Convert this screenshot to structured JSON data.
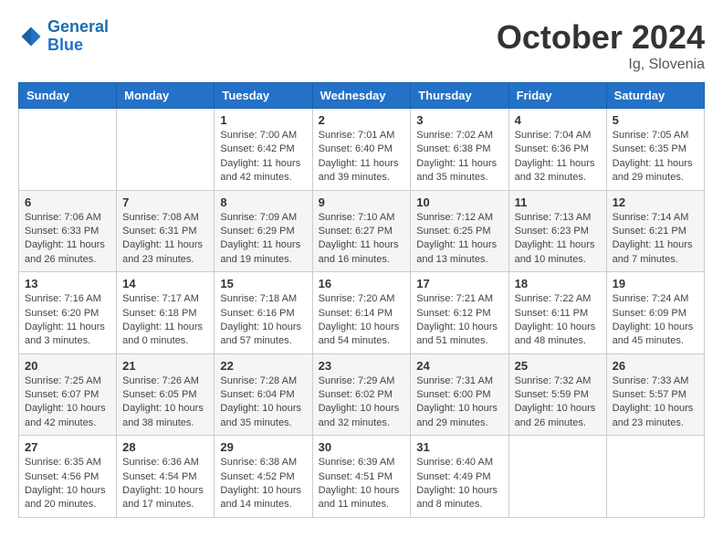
{
  "header": {
    "logo_general": "General",
    "logo_blue": "Blue",
    "month_title": "October 2024",
    "location": "Ig, Slovenia"
  },
  "weekdays": [
    "Sunday",
    "Monday",
    "Tuesday",
    "Wednesday",
    "Thursday",
    "Friday",
    "Saturday"
  ],
  "weeks": [
    [
      {
        "day": "",
        "info": ""
      },
      {
        "day": "",
        "info": ""
      },
      {
        "day": "1",
        "info": "Sunrise: 7:00 AM\nSunset: 6:42 PM\nDaylight: 11 hours and 42 minutes."
      },
      {
        "day": "2",
        "info": "Sunrise: 7:01 AM\nSunset: 6:40 PM\nDaylight: 11 hours and 39 minutes."
      },
      {
        "day": "3",
        "info": "Sunrise: 7:02 AM\nSunset: 6:38 PM\nDaylight: 11 hours and 35 minutes."
      },
      {
        "day": "4",
        "info": "Sunrise: 7:04 AM\nSunset: 6:36 PM\nDaylight: 11 hours and 32 minutes."
      },
      {
        "day": "5",
        "info": "Sunrise: 7:05 AM\nSunset: 6:35 PM\nDaylight: 11 hours and 29 minutes."
      }
    ],
    [
      {
        "day": "6",
        "info": "Sunrise: 7:06 AM\nSunset: 6:33 PM\nDaylight: 11 hours and 26 minutes."
      },
      {
        "day": "7",
        "info": "Sunrise: 7:08 AM\nSunset: 6:31 PM\nDaylight: 11 hours and 23 minutes."
      },
      {
        "day": "8",
        "info": "Sunrise: 7:09 AM\nSunset: 6:29 PM\nDaylight: 11 hours and 19 minutes."
      },
      {
        "day": "9",
        "info": "Sunrise: 7:10 AM\nSunset: 6:27 PM\nDaylight: 11 hours and 16 minutes."
      },
      {
        "day": "10",
        "info": "Sunrise: 7:12 AM\nSunset: 6:25 PM\nDaylight: 11 hours and 13 minutes."
      },
      {
        "day": "11",
        "info": "Sunrise: 7:13 AM\nSunset: 6:23 PM\nDaylight: 11 hours and 10 minutes."
      },
      {
        "day": "12",
        "info": "Sunrise: 7:14 AM\nSunset: 6:21 PM\nDaylight: 11 hours and 7 minutes."
      }
    ],
    [
      {
        "day": "13",
        "info": "Sunrise: 7:16 AM\nSunset: 6:20 PM\nDaylight: 11 hours and 3 minutes."
      },
      {
        "day": "14",
        "info": "Sunrise: 7:17 AM\nSunset: 6:18 PM\nDaylight: 11 hours and 0 minutes."
      },
      {
        "day": "15",
        "info": "Sunrise: 7:18 AM\nSunset: 6:16 PM\nDaylight: 10 hours and 57 minutes."
      },
      {
        "day": "16",
        "info": "Sunrise: 7:20 AM\nSunset: 6:14 PM\nDaylight: 10 hours and 54 minutes."
      },
      {
        "day": "17",
        "info": "Sunrise: 7:21 AM\nSunset: 6:12 PM\nDaylight: 10 hours and 51 minutes."
      },
      {
        "day": "18",
        "info": "Sunrise: 7:22 AM\nSunset: 6:11 PM\nDaylight: 10 hours and 48 minutes."
      },
      {
        "day": "19",
        "info": "Sunrise: 7:24 AM\nSunset: 6:09 PM\nDaylight: 10 hours and 45 minutes."
      }
    ],
    [
      {
        "day": "20",
        "info": "Sunrise: 7:25 AM\nSunset: 6:07 PM\nDaylight: 10 hours and 42 minutes."
      },
      {
        "day": "21",
        "info": "Sunrise: 7:26 AM\nSunset: 6:05 PM\nDaylight: 10 hours and 38 minutes."
      },
      {
        "day": "22",
        "info": "Sunrise: 7:28 AM\nSunset: 6:04 PM\nDaylight: 10 hours and 35 minutes."
      },
      {
        "day": "23",
        "info": "Sunrise: 7:29 AM\nSunset: 6:02 PM\nDaylight: 10 hours and 32 minutes."
      },
      {
        "day": "24",
        "info": "Sunrise: 7:31 AM\nSunset: 6:00 PM\nDaylight: 10 hours and 29 minutes."
      },
      {
        "day": "25",
        "info": "Sunrise: 7:32 AM\nSunset: 5:59 PM\nDaylight: 10 hours and 26 minutes."
      },
      {
        "day": "26",
        "info": "Sunrise: 7:33 AM\nSunset: 5:57 PM\nDaylight: 10 hours and 23 minutes."
      }
    ],
    [
      {
        "day": "27",
        "info": "Sunrise: 6:35 AM\nSunset: 4:56 PM\nDaylight: 10 hours and 20 minutes."
      },
      {
        "day": "28",
        "info": "Sunrise: 6:36 AM\nSunset: 4:54 PM\nDaylight: 10 hours and 17 minutes."
      },
      {
        "day": "29",
        "info": "Sunrise: 6:38 AM\nSunset: 4:52 PM\nDaylight: 10 hours and 14 minutes."
      },
      {
        "day": "30",
        "info": "Sunrise: 6:39 AM\nSunset: 4:51 PM\nDaylight: 10 hours and 11 minutes."
      },
      {
        "day": "31",
        "info": "Sunrise: 6:40 AM\nSunset: 4:49 PM\nDaylight: 10 hours and 8 minutes."
      },
      {
        "day": "",
        "info": ""
      },
      {
        "day": "",
        "info": ""
      }
    ]
  ]
}
